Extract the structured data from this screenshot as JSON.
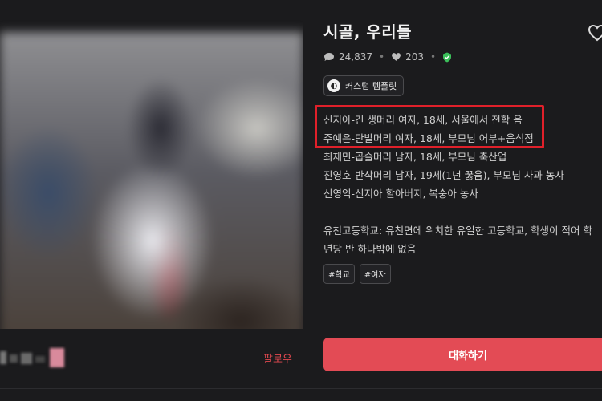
{
  "character": {
    "title": "시골, 우리들",
    "comments": "24,837",
    "likes": "203",
    "template_label": "커스텀 템플릿",
    "description": [
      "신지아-긴 생머리 여자, 18세, 서울에서 전학 옴",
      "주예은-단발머리 여자, 18세, 부모님 어부+음식점",
      "최재민-곱슬머리 남자, 18세, 부모님 축산업",
      "진영호-반삭머리 남자, 19세(1년 꿇음), 부모님 사과 농사",
      "신영익-신지아 할아버지, 복숭아 농사"
    ],
    "school_line1": "유천고등학교: 유천면에 위치한 유일한 고등학교, 학생이 적어 학",
    "school_line2": "년당 반 하나밖에 없음",
    "tags": [
      "#학교",
      "#여자"
    ]
  },
  "actions": {
    "follow_label": "팔로우",
    "chat_label": "대화하기"
  },
  "colors": {
    "background": "#1b1b1d",
    "accent": "#e34b55",
    "highlight_box": "#e0202a"
  }
}
